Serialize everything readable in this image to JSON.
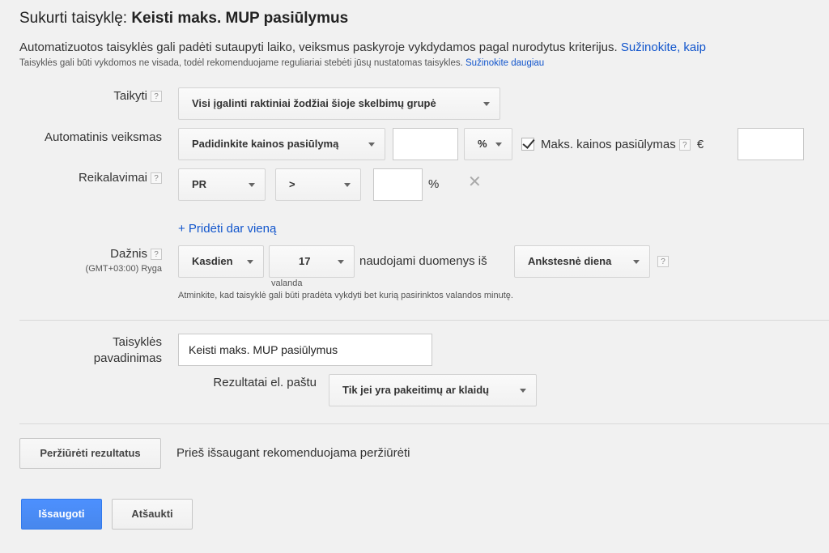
{
  "header": {
    "title_prefix": "Sukurti taisyklę:",
    "title_name": "Keisti maks. MUP pasiūlymus"
  },
  "intro": {
    "line1": "Automatizuotos taisyklės gali padėti sutaupyti laiko, veiksmus paskyroje vykdydamos pagal nurodytus kriterijus.",
    "line1_link": "Sužinokite, kaip",
    "line2": "Taisyklės gali būti vykdomos ne visada, todėl rekomenduojame reguliariai stebėti jūsų nustatomas taisykles.",
    "line2_link": "Sužinokite daugiau"
  },
  "apply": {
    "label": "Taikyti",
    "help": "?",
    "value": "Visi įgalinti raktiniai žodžiai šioje skelbimų grupė"
  },
  "action": {
    "label": "Automatinis veiksmas",
    "value": "Padidinkite kainos pasiūlymą",
    "amount": "",
    "unit": "%",
    "max_bid_checked": true,
    "max_bid_label": "Maks. kainos pasiūlymas",
    "help": "?",
    "currency": "€",
    "max_bid_value": ""
  },
  "requirements": {
    "label": "Reikalavimai",
    "help": "?",
    "metric": "PR",
    "operator": ">",
    "value": "",
    "unit": "%",
    "remove": "✕",
    "add_link": "+ Pridėti dar vieną"
  },
  "frequency": {
    "label": "Dažnis",
    "help": "?",
    "timezone": "(GMT+03:00) Ryga",
    "period": "Kasdien",
    "hour": "17",
    "hour_caption": "valanda",
    "data_from_label": "naudojami duomenys iš",
    "data_from": "Ankstesnė diena",
    "help2": "?",
    "note": "Atminkite, kad taisyklė gali būti pradėta vykdyti bet kurią pasirinktos valandos minutę."
  },
  "rule_name": {
    "label_line1": "Taisyklės",
    "label_line2": "pavadinimas",
    "value": "Keisti maks. MUP pasiūlymus"
  },
  "email": {
    "label": "Rezultatai el. paštu",
    "value": "Tik jei yra pakeitimų ar klaidų"
  },
  "preview": {
    "button": "Peržiūrėti rezultatus",
    "hint": "Prieš išsaugant rekomenduojama peržiūrėti"
  },
  "footer": {
    "save": "Išsaugoti",
    "cancel": "Atšaukti"
  }
}
